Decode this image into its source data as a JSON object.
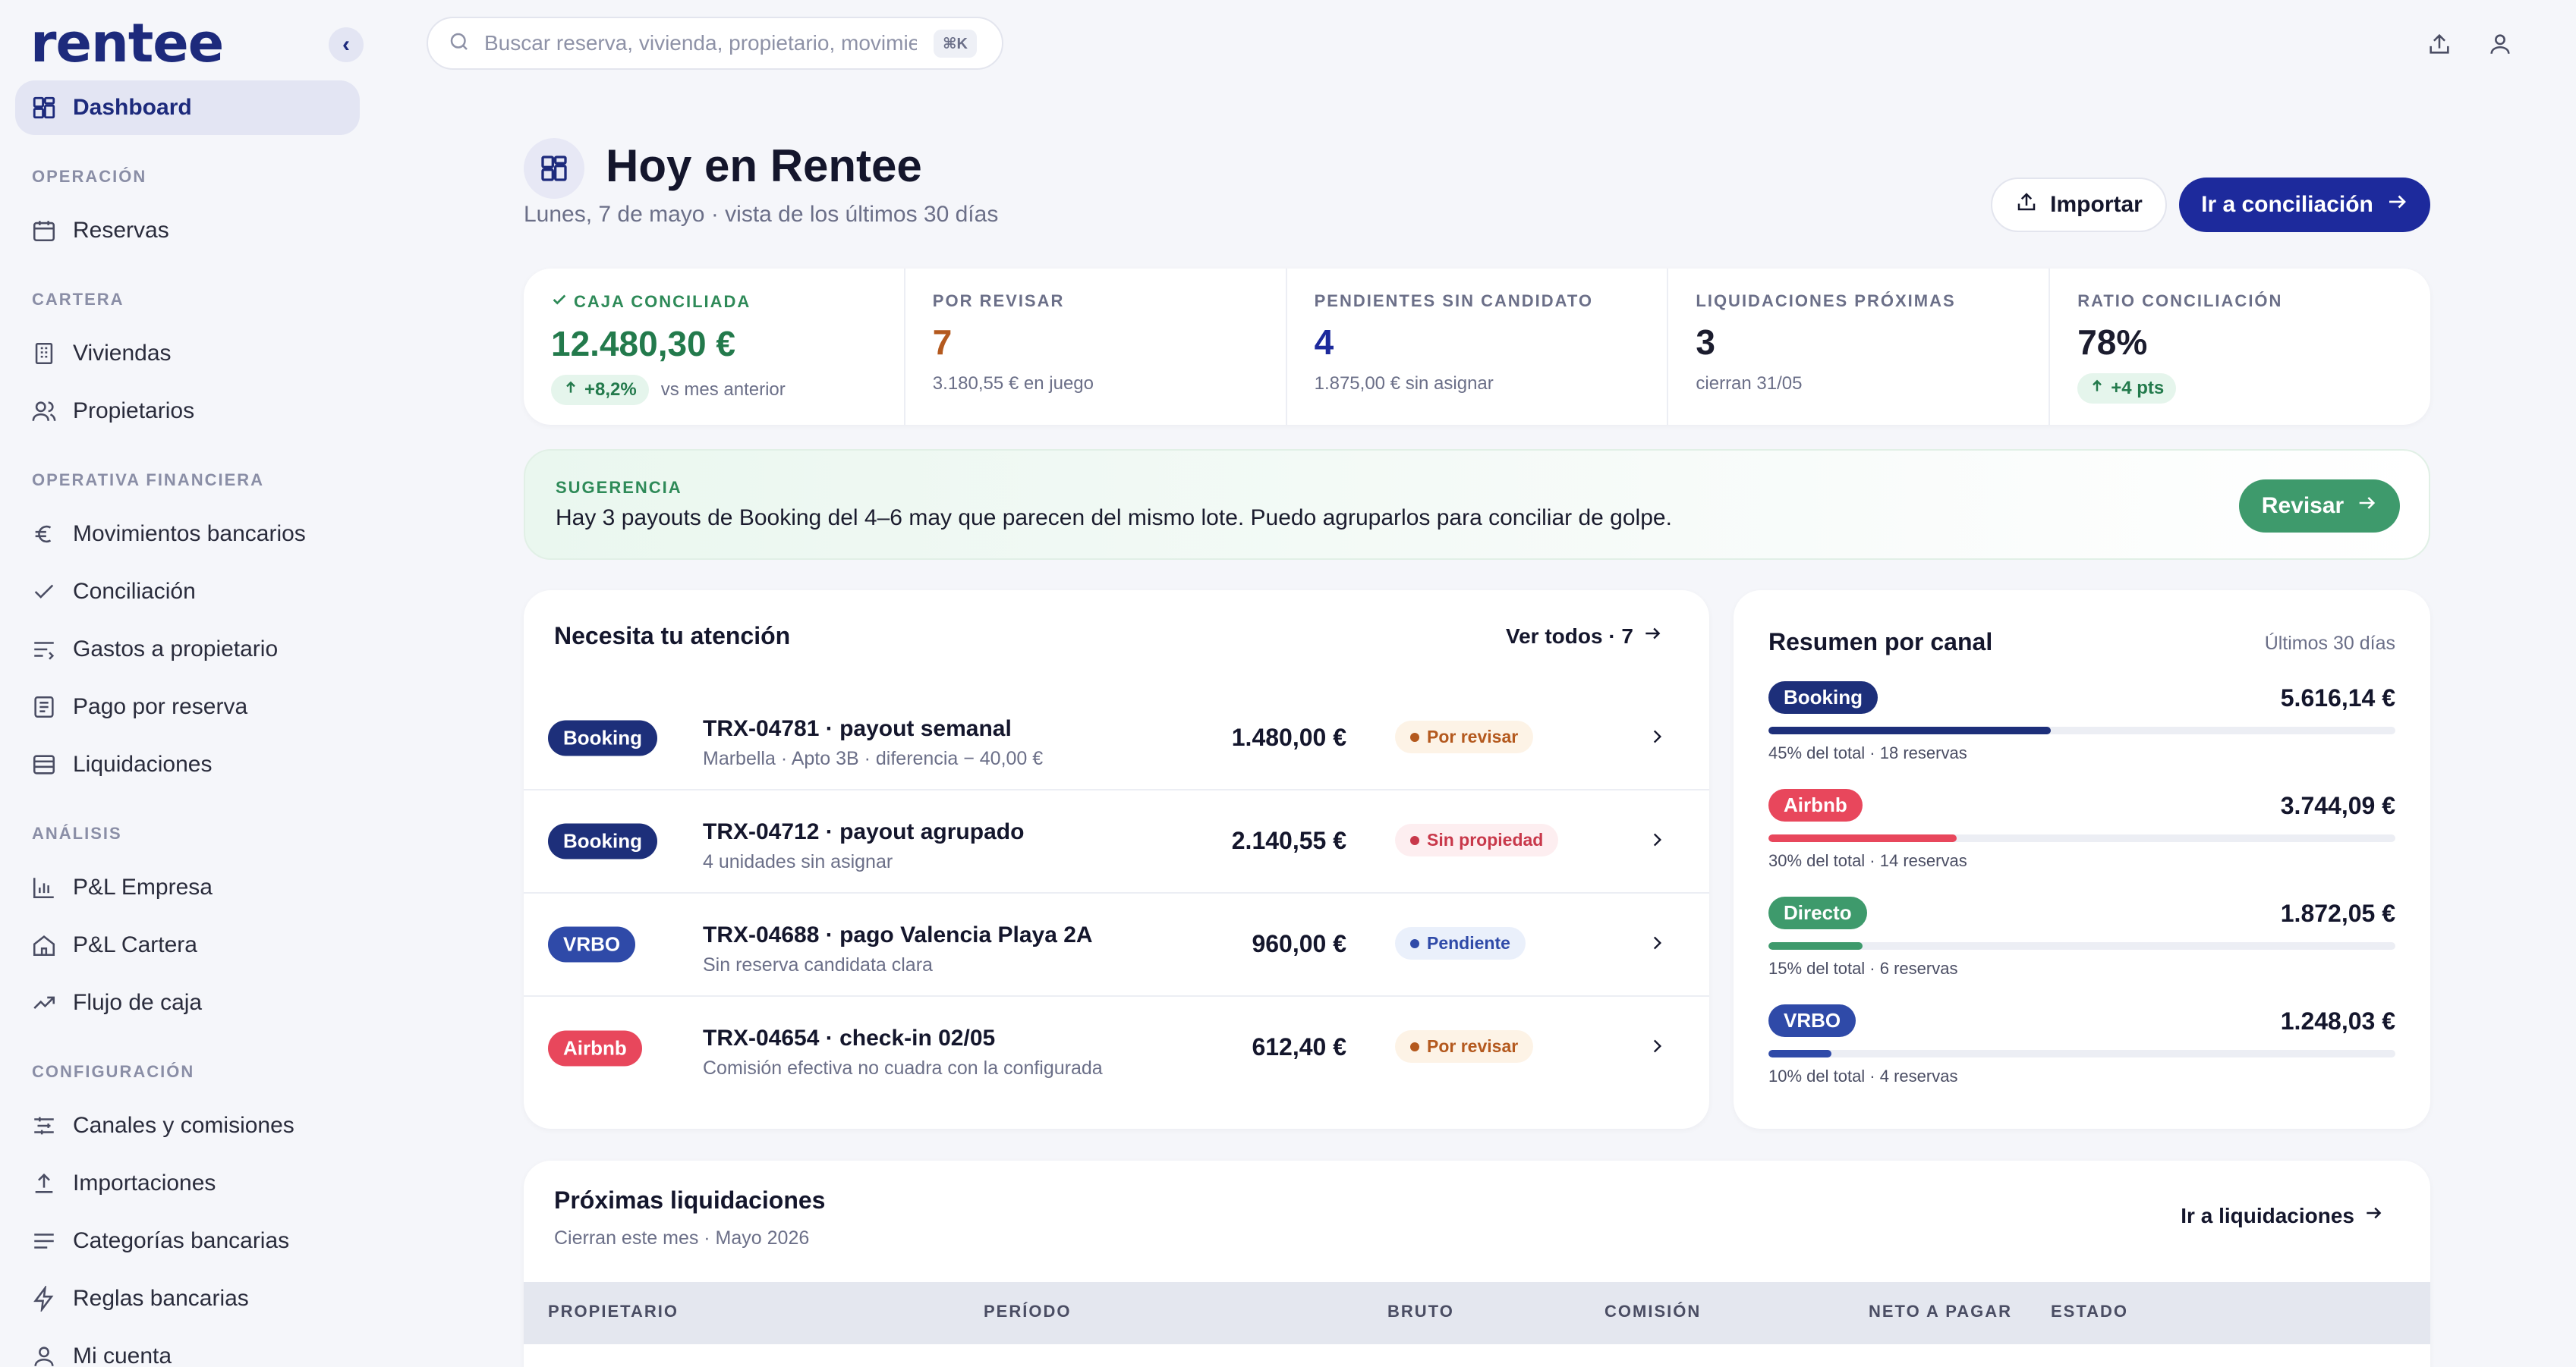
{
  "app": {
    "logo": "rentee"
  },
  "sidebar": {
    "dashboard": "Dashboard",
    "sections": {
      "operacion": "OPERACIÓN",
      "cartera": "CARTERA",
      "operativa": "OPERATIVA FINANCIERA",
      "analisis": "ANÁLISIS",
      "configuracion": "CONFIGURACIÓN"
    },
    "items": {
      "reservas": "Reservas",
      "viviendas": "Viviendas",
      "propietarios": "Propietarios",
      "movimientos": "Movimientos bancarios",
      "conciliacion": "Conciliación",
      "gastos": "Gastos a propietario",
      "pago": "Pago por reserva",
      "liquidaciones": "Liquidaciones",
      "pl_empresa": "P&L Empresa",
      "pl_cartera": "P&L Cartera",
      "flujo": "Flujo de caja",
      "canales": "Canales y comisiones",
      "importaciones": "Importaciones",
      "categorias": "Categorías bancarias",
      "reglas": "Reglas bancarias",
      "cuenta": "Mi cuenta"
    }
  },
  "search": {
    "placeholder": "Buscar reserva, vivienda, propietario, movimiento...",
    "shortcut": "⌘K"
  },
  "header": {
    "title": "Hoy en Rentee",
    "subtitle": "Lunes, 7 de mayo · vista de los últimos 30 días",
    "import_label": "Importar",
    "reconcile_label": "Ir a conciliación"
  },
  "kpis": {
    "caja": {
      "label": "CAJA CONCILIADA",
      "value": "12.480,30 €",
      "delta": "+8,2%",
      "note": "vs mes anterior",
      "color": "#237a4c"
    },
    "revisar": {
      "label": "POR REVISAR",
      "value": "7",
      "note": "3.180,55 € en juego",
      "color": "#b4591e"
    },
    "pendientes": {
      "label": "PENDIENTES SIN CANDIDATO",
      "value": "4",
      "note": "1.875,00 € sin asignar",
      "color": "#1d2a9c"
    },
    "liquidaciones": {
      "label": "LIQUIDACIONES PRÓXIMAS",
      "value": "3",
      "note": "cierran 31/05",
      "color": "#14162c"
    },
    "ratio": {
      "label": "RATIO CONCILIACIÓN",
      "value": "78%",
      "delta": "+4 pts",
      "color": "#14162c"
    }
  },
  "suggestion": {
    "label": "SUGERENCIA",
    "text": "Hay 3 payouts de Booking del 4–6 may que parecen del mismo lote. Puedo agruparlos para conciliar de golpe.",
    "button": "Revisar"
  },
  "attention": {
    "title": "Necesita tu atención",
    "see_all": "Ver todos · 7",
    "rows": [
      {
        "channel": "Booking",
        "title": "TRX-04781 · payout semanal",
        "desc": "Marbella · Apto 3B · diferencia − 40,00 €",
        "amount": "1.480,00 €",
        "status": "Por revisar"
      },
      {
        "channel": "Booking",
        "title": "TRX-04712 · payout agrupado",
        "desc": "4 unidades sin asignar",
        "amount": "2.140,55 €",
        "status": "Sin propiedad"
      },
      {
        "channel": "VRBO",
        "title": "TRX-04688 · pago Valencia Playa 2A",
        "desc": "Sin reserva candidata clara",
        "amount": "960,00 €",
        "status": "Pendiente"
      },
      {
        "channel": "Airbnb",
        "title": "TRX-04654 · check-in 02/05",
        "desc": "Comisión efectiva no cuadra con la configurada",
        "amount": "612,40 €",
        "status": "Por revisar"
      }
    ]
  },
  "summary": {
    "title": "Resumen por canal",
    "period": "Últimos 30 días",
    "channels": [
      {
        "name": "Booking",
        "amount": "5.616,14 €",
        "share": 0.45,
        "desc": "45% del total · 18 reservas",
        "color": "#1d2f7a"
      },
      {
        "name": "Airbnb",
        "amount": "3.744,09 €",
        "share": 0.3,
        "desc": "30% del total · 14 reservas",
        "color": "#e8475c"
      },
      {
        "name": "Directo",
        "amount": "1.872,05 €",
        "share": 0.15,
        "desc": "15% del total · 6 reservas",
        "color": "#3e9a6c"
      },
      {
        "name": "VRBO",
        "amount": "1.248,03 €",
        "share": 0.1,
        "desc": "10% del total · 4 reservas",
        "color": "#2f4aa8"
      }
    ]
  },
  "liquidaciones": {
    "title": "Próximas liquidaciones",
    "subtitle": "Cierran este mes · Mayo 2026",
    "link": "Ir a liquidaciones",
    "columns": [
      "PROPIETARIO",
      "PERÍODO",
      "BRUTO",
      "COMISIÓN",
      "NETO A PAGAR",
      "ESTADO"
    ]
  },
  "colors": {
    "brand": "#1d2a7c",
    "primary_button": "#1d2a9c",
    "channel_booking": "#1d2f7a",
    "channel_airbnb": "#e8475c",
    "channel_vrbo": "#2f4aa8",
    "channel_directo": "#3e9a6c",
    "status_review_bg": "#fdf3e6",
    "status_review_fg": "#b4591e",
    "status_noprop_bg": "#fdeef0",
    "status_noprop_fg": "#c8384a",
    "status_pending_bg": "#eaf0fb",
    "status_pending_fg": "#2f4aa8"
  },
  "icons": {
    "dashboard": "dashboard-grid-icon",
    "search": "search-icon",
    "export": "upload-icon",
    "user": "user-icon",
    "calendar": "calendar-icon",
    "building": "building-icon",
    "users": "users-icon",
    "euro": "euro-icon",
    "check": "check-icon",
    "list": "list-icon",
    "receipt": "receipt-icon",
    "card": "card-icon",
    "chart": "bar-chart-icon",
    "home": "home-icon",
    "trend": "trend-up-icon",
    "sliders": "sliders-icon",
    "bolt": "bolt-icon",
    "arrow": "arrow-right-icon",
    "chevron": "chevron-right-icon"
  }
}
